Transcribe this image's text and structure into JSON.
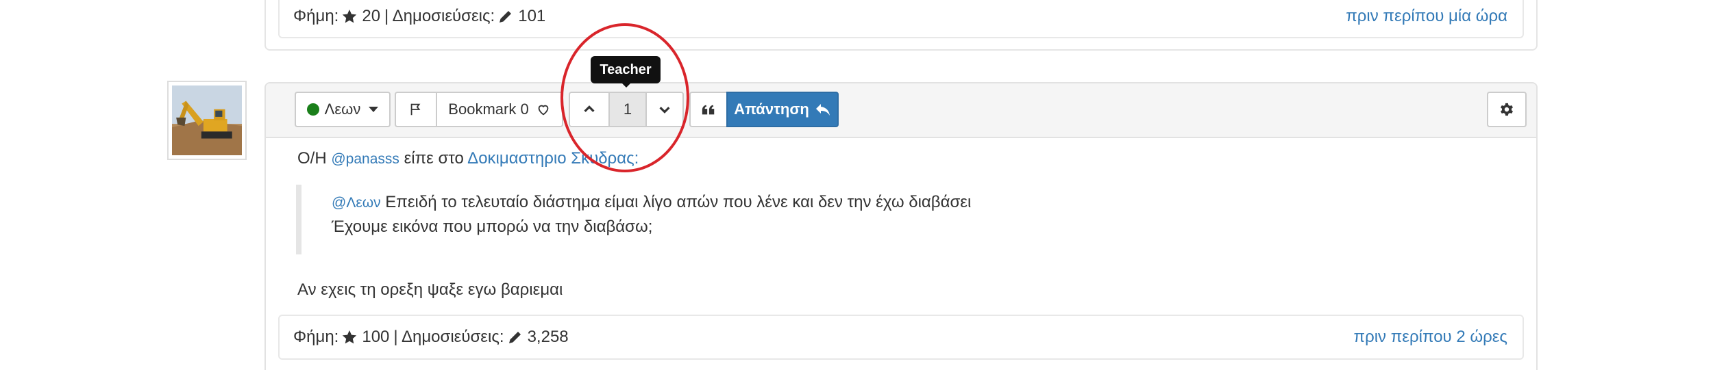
{
  "previous_post": {
    "reputation_label": "Φήμη:",
    "reputation_value": "20",
    "posts_label": "| Δημοσιεύσεις:",
    "posts_value": "101",
    "time_ago": "πριν περίπου μία ώρα"
  },
  "post": {
    "author_button": "Λεων",
    "bookmark_label": "Bookmark 0",
    "vote_count": "1",
    "vote_tooltip": "Teacher",
    "reply_label": "Απάντηση",
    "intro": {
      "prefix": "Ο/Η",
      "mention": "@panasss",
      "middle": "είπε στο",
      "topic_link": "Δοκιμαστηριο Σκυδρας:"
    },
    "quote": {
      "mention": "@Λεων",
      "line1": "Επειδή το τελευταίο διάστημα είμαι λίγο απών που λένε και δεν την έχω διαβάσει",
      "line2": "Έχουμε εικόνα που μπορώ να την διαβάσω;"
    },
    "reply_text": "Αν εχεις τη ορεξη ψαξε εγω βαριεμαι",
    "footer": {
      "reputation_label": "Φήμη:",
      "reputation_value": "100",
      "posts_label": "| Δημοσιεύσεις:",
      "posts_value": "3,258",
      "time_ago": "πριν περίπου 2 ώρες"
    }
  },
  "colors": {
    "link": "#337ab7",
    "primary_button": "#337ab7",
    "online_dot": "#1a7f1a",
    "annotation": "#d9252b",
    "tooltip_bg": "#111111"
  },
  "icons": {
    "reputation": "star-icon",
    "posts": "pencil-icon",
    "flag": "flag-icon",
    "bookmark": "heart-icon",
    "upvote": "chevron-up-icon",
    "downvote": "chevron-down-icon",
    "quote": "quote-icon",
    "reply": "reply-icon",
    "tools": "gear-icon"
  }
}
